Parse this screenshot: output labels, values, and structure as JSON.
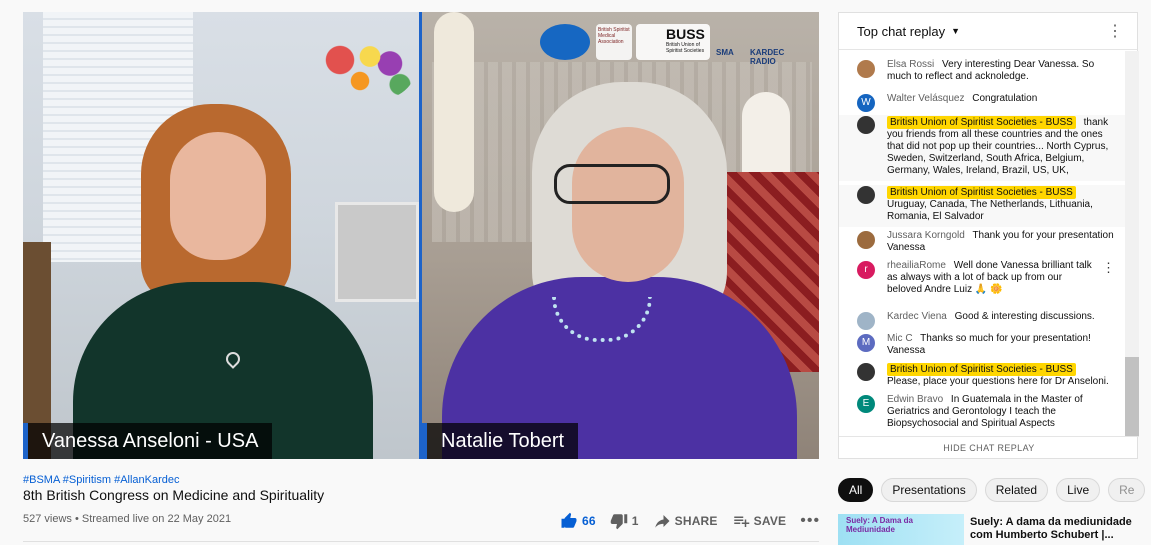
{
  "video": {
    "left_name": "Vanessa Anseloni - USA",
    "right_name": "Natalie Tobert",
    "logos": {
      "bsma": "British Spiritist Medical Association",
      "buss": "BUSS",
      "buss_sub": "British Union of Spiritist Societies",
      "sma": "SMA",
      "kardec": "KARDEC RADIO"
    }
  },
  "info": {
    "hashtags": "#BSMA #Spiritism #AllanKardec",
    "title": "8th British Congress on Medicine and Spirituality",
    "meta": "527 views • Streamed live on 22 May 2021",
    "likes": "66",
    "dislikes": "1",
    "share": "SHARE",
    "save": "SAVE"
  },
  "chat": {
    "header": "Top chat replay",
    "footer": "HIDE CHAT REPLAY",
    "messages": [
      {
        "author": "Elsa Rossi",
        "text": "Very interesting Dear Vanessa. So much to reflect and acknoledge.",
        "avatar": "",
        "color": "#b07a4c"
      },
      {
        "author": "Walter Velásquez",
        "text": "Congratulation",
        "avatar": "W",
        "color": "#1565c0"
      },
      {
        "author": "British Union of Spiritist Societies - BUSS",
        "text": "thank you friends from all these countries and the ones that did not pop up their countries... North Cyprus, Sweden, Switzerland, South Africa, Belgium, Germany, Wales, Ireland, Brazil, US, UK,",
        "avatar": "",
        "color": "#333333"
      },
      {
        "author": "British Union of Spiritist Societies - BUSS",
        "text": "Uruguay, Canada, The Netherlands, Lithuania, Romania, El Salvador",
        "avatar": "",
        "color": "#333333"
      },
      {
        "author": "Jussara Korngold",
        "text": "Thank you for your presentation Vanessa",
        "avatar": "",
        "color": "#9c6b3e"
      },
      {
        "author": "rheailiaRome",
        "text": "Well done Vanessa brilliant talk as always with a lot of back up from our beloved Andre Luiz 🙏 🌼",
        "avatar": "r",
        "color": "#d81b60"
      },
      {
        "author": "Kardec Viena",
        "text": "Good & interesting discussions.",
        "avatar": "",
        "color": "#9fb4c7"
      },
      {
        "author": "Mic C",
        "text": "Thanks so much for your presentation! Vanessa",
        "avatar": "M",
        "color": "#5c6bc0"
      },
      {
        "author": "British Union of Spiritist Societies - BUSS",
        "text": "Please, place your questions here for Dr Anseloni.",
        "avatar": "",
        "color": "#333333"
      },
      {
        "author": "Edwin Bravo",
        "text": "In Guatemala in the Master of Geriatrics and Gerontology I teach the Biopsychosocial and Spiritual Aspects",
        "avatar": "E",
        "color": "#00897b"
      }
    ]
  },
  "chips": [
    "All",
    "Presentations",
    "Related",
    "Live",
    "Re"
  ],
  "recommendation": {
    "thumb_text": "Suely: A Dama da Mediunidade",
    "title": "Suely: A dama da mediunidade com Humberto Schubert |..."
  }
}
